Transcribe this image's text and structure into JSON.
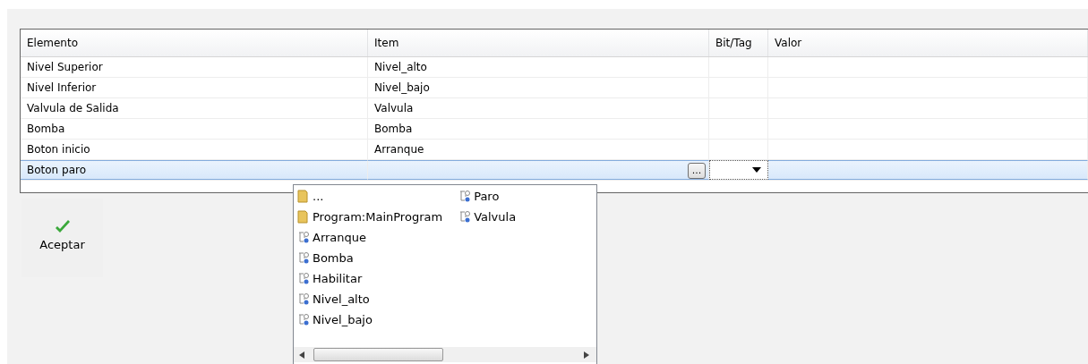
{
  "table": {
    "columns": [
      "Elemento",
      "Item",
      "Bit/Tag",
      "Valor"
    ],
    "rows": [
      {
        "elemento": "Nivel Superior",
        "item": "Nivel_alto",
        "selected": false
      },
      {
        "elemento": "Nivel Inferior",
        "item": "Nivel_bajo",
        "selected": false
      },
      {
        "elemento": "Valvula de Salida",
        "item": "Valvula",
        "selected": false
      },
      {
        "elemento": "Bomba",
        "item": "Bomba",
        "selected": false
      },
      {
        "elemento": "Boton inicio",
        "item": "Arranque",
        "selected": false
      },
      {
        "elemento": "Boton paro",
        "selected": true,
        "editing": true
      }
    ]
  },
  "browse_button": {
    "label": "..."
  },
  "dropdown_list": {
    "items": [
      {
        "kind": "folder",
        "label": "..."
      },
      {
        "kind": "folder",
        "label": "Program:MainProgram"
      },
      {
        "kind": "tag",
        "label": "Arranque"
      },
      {
        "kind": "tag",
        "label": "Bomba"
      },
      {
        "kind": "tag",
        "label": "Habilitar"
      },
      {
        "kind": "tag",
        "label": "Nivel_alto"
      },
      {
        "kind": "tag",
        "label": "Nivel_bajo"
      },
      {
        "kind": "tag",
        "label": "Paro"
      },
      {
        "kind": "tag",
        "label": "Valvula"
      }
    ]
  },
  "accept_button": {
    "label": "Aceptar"
  }
}
